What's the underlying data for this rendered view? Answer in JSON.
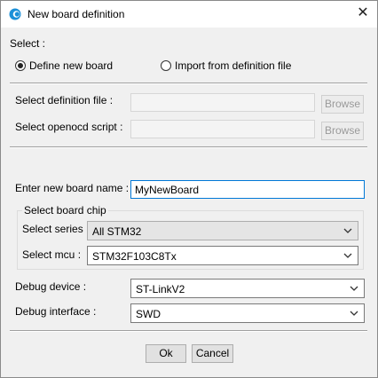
{
  "window": {
    "title": "New board definition"
  },
  "select": {
    "label": "Select :",
    "options": [
      {
        "label": "Define new board",
        "selected": true
      },
      {
        "label": "Import from definition file",
        "selected": false
      }
    ]
  },
  "import": {
    "definition_label": "Select definition file :",
    "definition_value": "",
    "openocd_label": "Select openocd script :",
    "openocd_value": "",
    "browse_label": "Browse"
  },
  "board": {
    "name_label": "Enter new board name :",
    "name_value": "MyNewBoard"
  },
  "chip": {
    "group_title": "Select board chip",
    "series_label": "Select series :",
    "series_value": "All STM32",
    "mcu_label": "Select mcu :",
    "mcu_value": "STM32F103C8Tx"
  },
  "debug": {
    "device_label": "Debug device :",
    "device_value": "ST-LinkV2",
    "interface_label": "Debug interface :",
    "interface_value": "SWD"
  },
  "buttons": {
    "ok": "Ok",
    "cancel": "Cancel"
  },
  "colors": {
    "accent": "#0078d7",
    "titlebar": "#ffffff",
    "dialog": "#f0f0f0"
  },
  "icons": {
    "app": "eclipse-app-icon",
    "close": "close-icon",
    "dropdown": "chevron-down-icon"
  }
}
